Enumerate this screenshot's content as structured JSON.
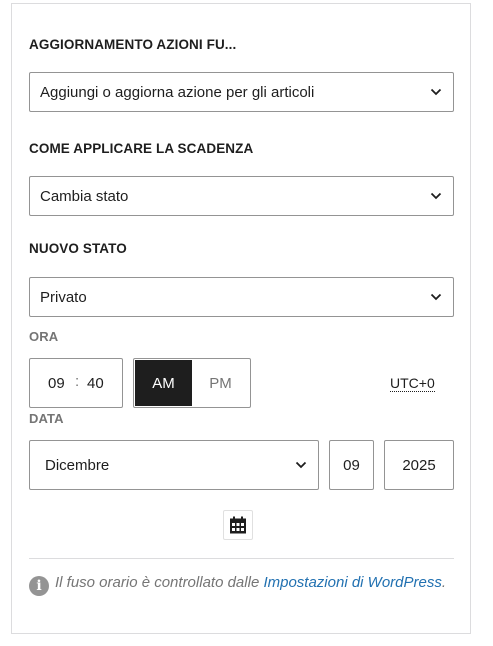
{
  "section1": {
    "label": "AGGIORNAMENTO AZIONI FU...",
    "value": "Aggiungi o aggiorna azione per gli articoli"
  },
  "section2": {
    "label": "COME APPLICARE LA SCADENZA",
    "value": "Cambia stato"
  },
  "section3": {
    "label": "NUOVO STATO",
    "value": "Privato"
  },
  "time": {
    "label": "ORA",
    "hour": "09",
    "separator": ":",
    "minute": "40",
    "am_label": "AM",
    "pm_label": "PM",
    "selected": "AM",
    "timezone": "UTC+0"
  },
  "date": {
    "label": "DATA",
    "month": "Dicembre",
    "day": "09",
    "year": "2025"
  },
  "footer": {
    "info_icon": "i",
    "text_before": "Il fuso orario è controllato dalle ",
    "link_text": "Impostazioni di WordPress",
    "text_after": "."
  },
  "icons": {
    "chevron": "chevron-down-icon",
    "calendar": "calendar-icon",
    "info": "info-icon"
  },
  "colors": {
    "link": "#2271b1",
    "selected_bg": "#1e1e1e",
    "muted": "#757575",
    "border": "#949494"
  }
}
